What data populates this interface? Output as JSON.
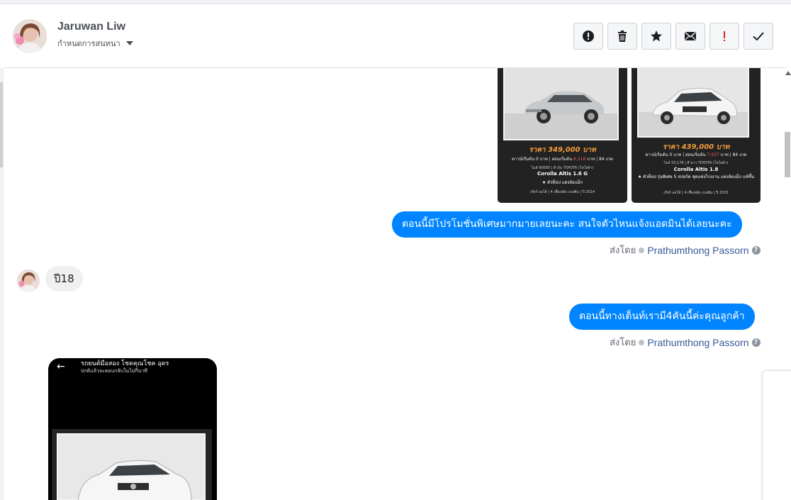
{
  "header": {
    "contact_name": "Jaruwan Liw",
    "assign_label": "กำหนดการสนทนา",
    "actions": [
      {
        "name": "report-spam-button",
        "icon": "alert-circle-icon"
      },
      {
        "name": "delete-button",
        "icon": "trash-icon"
      },
      {
        "name": "star-button",
        "icon": "star-icon"
      },
      {
        "name": "mark-unread-button",
        "icon": "envelope-icon"
      },
      {
        "name": "follow-up-button",
        "icon": "exclamation-icon"
      },
      {
        "name": "mark-done-button",
        "icon": "check-icon"
      }
    ]
  },
  "cars": [
    {
      "price": "ราคา 349,000 บาท",
      "terms_a": "ดาวน์เริ่มต้น 0 บาท | ผ่อนเริ่มต้น ",
      "terms_b": "6,318",
      "terms_c": " บาท | 84 งวด",
      "specs": "ไมล์ 90000 | สี เงิน  TOYOTA (โตโยต้า)",
      "model": "Corolla Altis 1.6 G",
      "features": "★ ตัวท็อป แต่งล้อแม็ก",
      "footer": "เกียร์ ออโต้  |  4 เชื้อเพลิง เบนซิน  |  ปี 2014"
    },
    {
      "price": "ราคา 439,000 บาท",
      "terms_a": "ดาวน์เริ่มต้น 0 บาท | ผ่อนเริ่มต้น ",
      "terms_b": "7,937",
      "terms_c": " บาท | 84 งวด",
      "specs": "ไมล์ 53,176 | สี ขาว  TOYOTA (โตโยต้า)",
      "model": "Corolla Altis 1.8",
      "features": "★ ตัวท็อป รุ่นพิเศษ S สปอร์ต ชุดแต่งโรงงาน แต่งล้อแม็ก แท้ขึ้น",
      "footer": "เกียร์ ออโต้  |  4 เชื้อเพลิง เบนซิน  |  ปี 2015"
    }
  ],
  "messages": {
    "promo": "ตอนนี้มีโปรโมชั่นพิเศษมากมายเลยนะคะ สนใจตัวไหนแจ้งแอดมินได้เลยนะคะ",
    "incoming_year": "ปี18",
    "stock": "ตอนนี้ทางเต็นท์เรามี4คันนี้ค่ะคุณลูกค้า",
    "sent_by_label": "ส่งโดย",
    "agent_name": "Prathumthong Passorn",
    "help": "?"
  },
  "screenshot": {
    "back": "←",
    "title": "รถยนต์มือสอง โชคคุณโชค อุดร",
    "subtitle": "ปกติแล้วจะตอบกลับในไม่กี่นาที"
  },
  "colors": {
    "accent": "#0084ff",
    "link": "#385898"
  }
}
